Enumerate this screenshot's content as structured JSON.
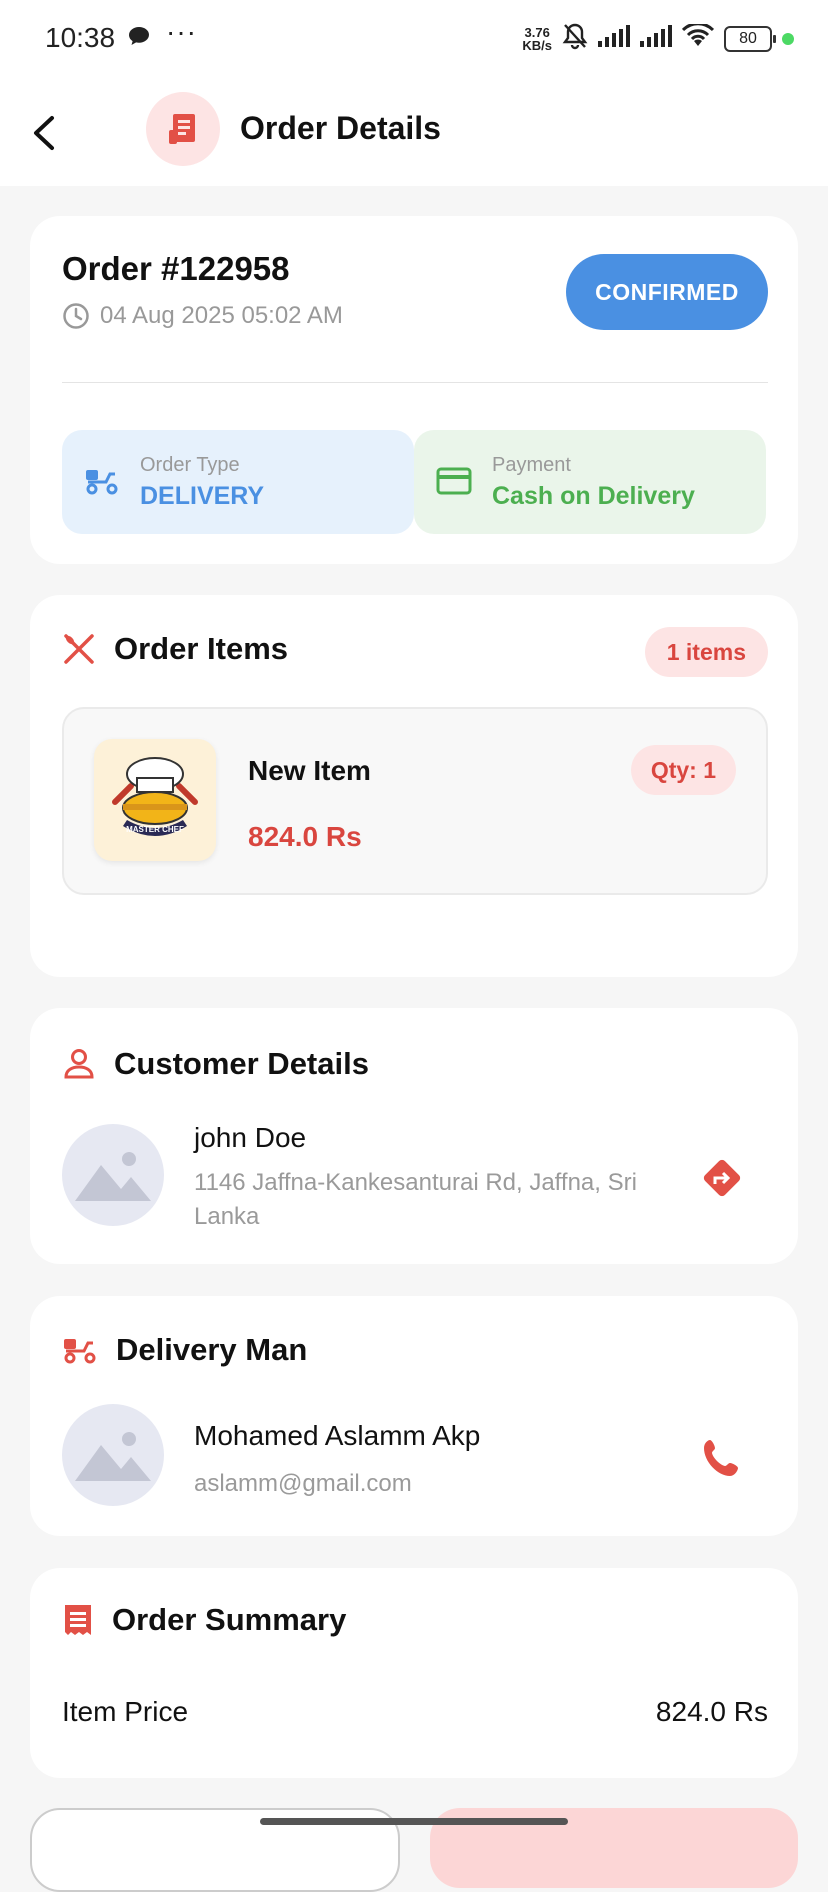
{
  "status_bar": {
    "time": "10:38",
    "net_speed_value": "3.76",
    "net_speed_unit": "KB/s",
    "battery": "80"
  },
  "appbar": {
    "title": "Order Details"
  },
  "order": {
    "id": "Order #122958",
    "date": "04 Aug 2025 05:02 AM",
    "status": "CONFIRMED",
    "type_label": "Order Type",
    "type_value": "DELIVERY",
    "payment_label": "Payment",
    "payment_value": "Cash on Delivery"
  },
  "items_section": {
    "title": "Order Items",
    "count": "1 items",
    "items": [
      {
        "name": "New Item",
        "price": "824.0 Rs",
        "qty": "Qty: 1",
        "logo_text": "MASTER CHEF"
      }
    ]
  },
  "customer": {
    "title": "Customer Details",
    "name": "john Doe",
    "address": "1146 Jaffna-Kankesanturai Rd, Jaffna, Sri Lanka"
  },
  "delivery": {
    "title": "Delivery Man",
    "name": "Mohamed Aslamm Akp",
    "email": "aslamm@gmail.com"
  },
  "summary": {
    "title": "Order Summary",
    "rows": [
      {
        "label": "Item Price",
        "value": "824.0 Rs"
      }
    ]
  },
  "colors": {
    "accent": "#d9463f",
    "status_blue": "#4a90e2",
    "payment_green": "#4caf50",
    "type_bg": "#e6f1fc",
    "payment_bg": "#eaf5ea"
  },
  "icons": {
    "back": "arrow-back-icon",
    "receipt": "receipt-icon",
    "clock": "clock-icon",
    "scooter": "scooter-icon",
    "card": "credit-card-icon",
    "utensils": "utensils-icon",
    "person": "person-icon",
    "directions": "directions-icon",
    "phone": "phone-icon",
    "image_placeholder": "image-placeholder-icon"
  }
}
